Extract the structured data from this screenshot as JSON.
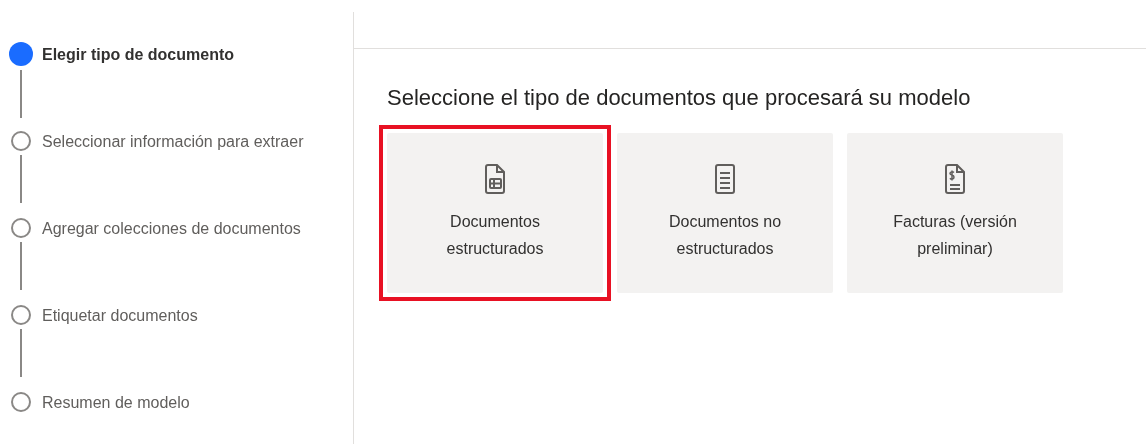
{
  "steps": [
    {
      "label": "Elegir tipo de documento",
      "selected": true
    },
    {
      "label": "Seleccionar información para extraer",
      "selected": false
    },
    {
      "label": "Agregar colecciones de documentos",
      "selected": false
    },
    {
      "label": "Etiquetar documentos",
      "selected": false
    },
    {
      "label": "Resumen de modelo",
      "selected": false
    }
  ],
  "heading": "Seleccione el tipo de documentos que procesará su modelo",
  "options": [
    {
      "kind": "structured",
      "label": "Documentos estructurados",
      "selected": true
    },
    {
      "kind": "unstructured",
      "label": "Documentos no estructurados",
      "selected": false
    },
    {
      "kind": "invoice",
      "label": "Facturas (versión preliminar)",
      "selected": false
    }
  ]
}
